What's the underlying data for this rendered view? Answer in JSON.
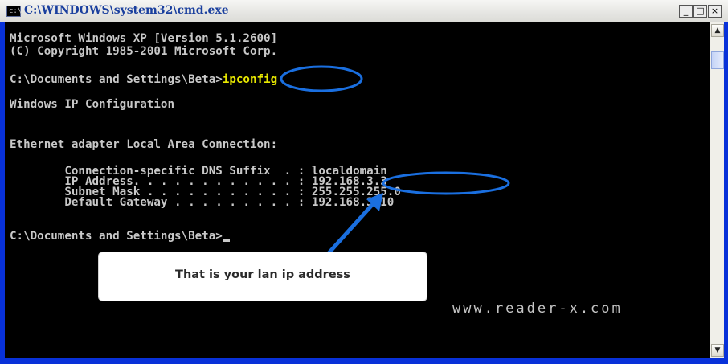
{
  "window": {
    "title": "C:\\WINDOWS\\system32\\cmd.exe",
    "icon_text": "c:\\",
    "buttons": {
      "minimize": "_",
      "maximize": "□",
      "close": "×"
    }
  },
  "console": {
    "lines": [
      "Microsoft Windows XP [Version 5.1.2600]",
      "(C) Copyright 1985-2001 Microsoft Corp.",
      "",
      "",
      "Windows IP Configuration",
      "",
      "",
      "Ethernet adapter Local Area Connection:",
      "",
      "        Connection-specific DNS Suffix  . : localdomain",
      "        IP Address. . . . . . . . . . . . : 192.168.3.3",
      "        Subnet Mask . . . . . . . . . . . : 255.255.255.0",
      "        Default Gateway . . . . . . . . . : 192.168.3.10",
      "",
      ""
    ],
    "prompt1": "C:\\Documents and Settings\\Beta>",
    "command": "ipconfig",
    "prompt2": "C:\\Documents and Settings\\Beta>"
  },
  "annotation": {
    "callout_text": "That is your lan ip address",
    "watermark": "www.reader-x.com",
    "highlight_color": "#1a6fe0"
  }
}
